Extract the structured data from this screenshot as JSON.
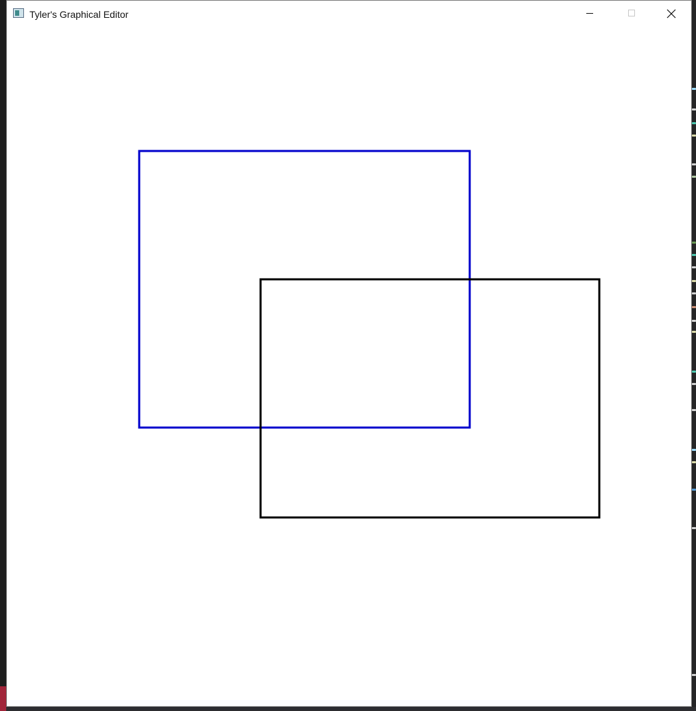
{
  "window": {
    "title": "Tyler's Graphical Editor",
    "icon": "app-window-icon",
    "controls": {
      "minimize_icon": "minimize-icon",
      "maximize_icon": "maximize-icon",
      "close_icon": "close-icon"
    }
  },
  "canvas": {
    "background": "#ffffff",
    "shapes": [
      {
        "type": "rectangle",
        "stroke": "#0000cc"
      },
      {
        "type": "rectangle",
        "stroke": "#000000"
      }
    ]
  }
}
